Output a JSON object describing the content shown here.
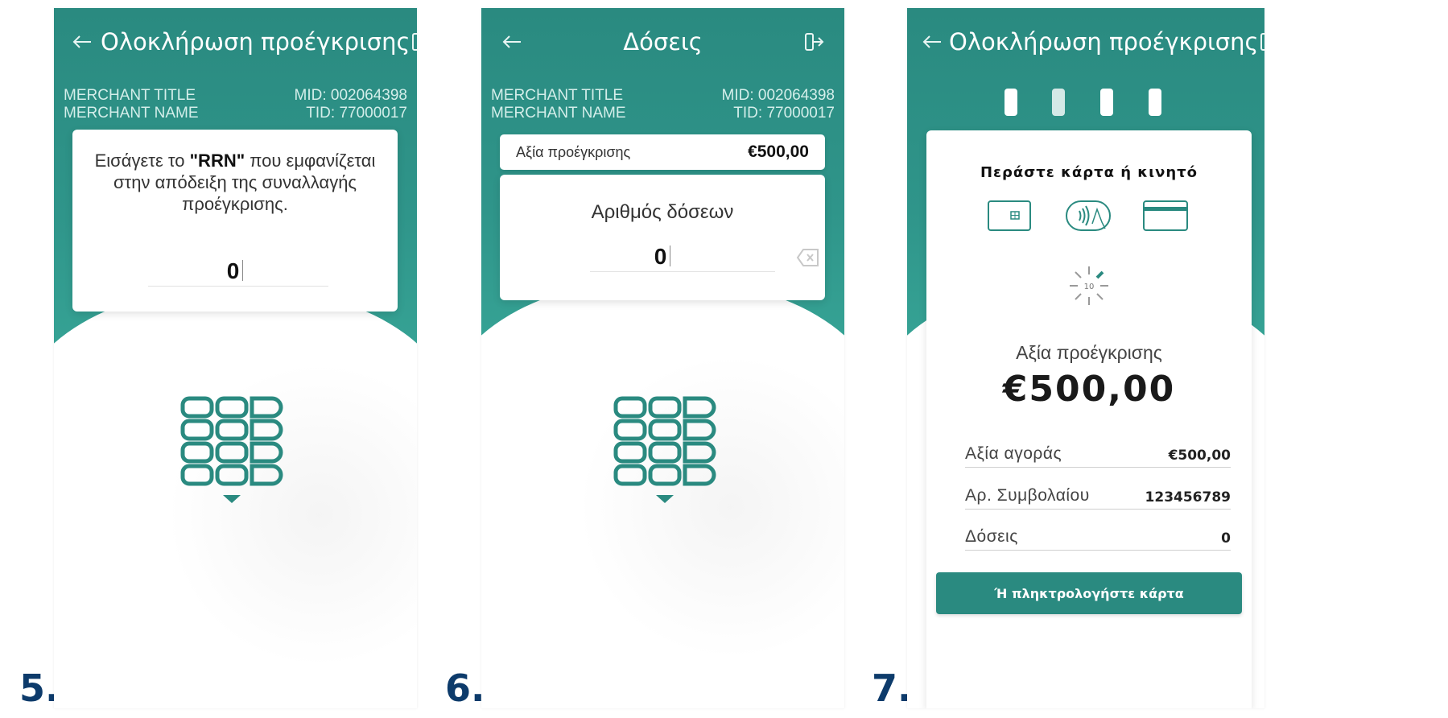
{
  "steps": [
    "5.",
    "6.",
    "7."
  ],
  "merchant": {
    "title": "MERCHANT TITLE",
    "name": "MERCHANT NAME",
    "mid": "MID: 002064398",
    "tid": "TID: 77000017"
  },
  "screen5": {
    "title": "Ολοκλήρωση προέγκρισης",
    "instruction_pre": "Εισάγετε το ",
    "instruction_bold": "\"RRN\"",
    "instruction_post": " που εμφανίζεται στην απόδειξη της συναλλαγής προέγκρισης.",
    "entry_value": "0"
  },
  "screen6": {
    "title": "Δόσεις",
    "amount_label": "Αξία προέγκρισης",
    "amount_value": "€500,00",
    "prompt": "Αριθμός δόσεων",
    "entry_value": "0"
  },
  "screen7": {
    "title": "Ολοκλήρωση προέγκρισης",
    "prompt": "Περάστε κάρτα ή κινητό",
    "timer": "10",
    "amount_label": "Αξία προέγκρισης",
    "amount_value": "€500,00",
    "details": [
      {
        "label": "Αξία αγοράς",
        "value": "€500,00"
      },
      {
        "label": "Αρ. Συμβολαίου",
        "value": "123456789"
      },
      {
        "label": "Δόσεις",
        "value": "0"
      }
    ],
    "button_label": "Ή πληκτρολογήστε κάρτα"
  },
  "colors": {
    "teal": "#2a8a80",
    "step_number": "#0d3b6b"
  }
}
